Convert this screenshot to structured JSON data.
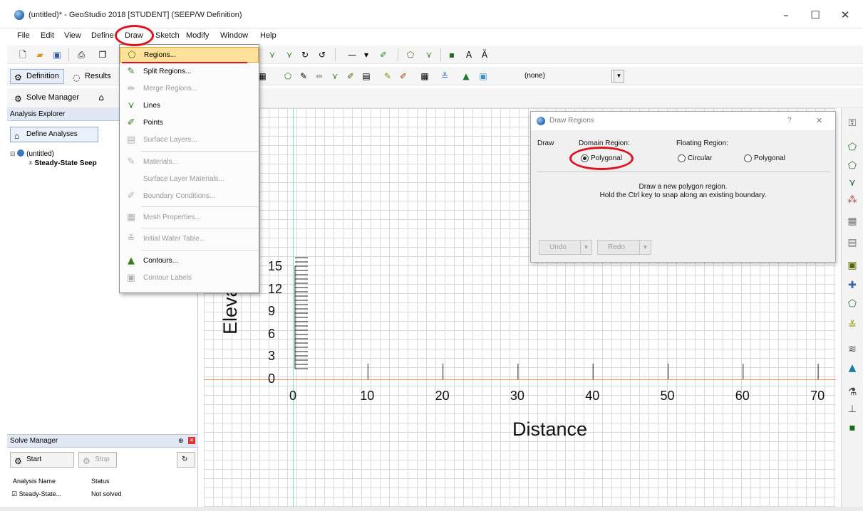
{
  "window": {
    "title": "(untitled)* - GeoStudio 2018 [STUDENT] (SEEP/W Definition)",
    "minimize": "–",
    "maximize": "☐",
    "close": "✕"
  },
  "menu": [
    "File",
    "Edit",
    "View",
    "Define",
    "Draw",
    "Sketch",
    "Modify",
    "Window",
    "Help"
  ],
  "toolbar": {
    "definition_label": "Definition",
    "results_label": "Results",
    "solve_manager_label": "Solve Manager",
    "combo_value": "(none)"
  },
  "explorer": {
    "title": "Analysis Explorer",
    "define_button": "Define Analyses",
    "tree_root": "(untitled)",
    "tree_child": "Steady-State Seep"
  },
  "solve_manager": {
    "title": "Solve Manager",
    "start_label": "Start",
    "stop_label": "Stop",
    "col_name": "Analysis Name",
    "col_status": "Status",
    "rows": [
      {
        "name": "Steady-State...",
        "status": "Not solved"
      }
    ]
  },
  "draw_menu": {
    "items": [
      {
        "label": "Regions...",
        "icon": "regions-icon",
        "glyph": "⬠",
        "disabled": false,
        "highlight": true
      },
      {
        "label": "Split Regions...",
        "icon": "split-regions-icon",
        "glyph": "✎",
        "disabled": false
      },
      {
        "label": "Merge Regions...",
        "icon": "merge-regions-icon",
        "glyph": "⇹",
        "disabled": true
      },
      {
        "label": "Lines",
        "icon": "lines-icon",
        "glyph": "⋎",
        "disabled": false
      },
      {
        "label": "Points",
        "icon": "points-icon",
        "glyph": "✐",
        "disabled": false
      },
      {
        "label": "Surface Layers...",
        "icon": "surface-layers-icon",
        "glyph": "▤",
        "disabled": true
      },
      {
        "label": "Materials...",
        "icon": "materials-icon",
        "glyph": "✎",
        "disabled": true
      },
      {
        "label": "Surface Layer Materials...",
        "icon": "",
        "glyph": "",
        "disabled": true
      },
      {
        "label": "Boundary Conditions...",
        "icon": "boundary-conditions-icon",
        "glyph": "✐",
        "disabled": true
      },
      {
        "label": "Mesh Properties...",
        "icon": "mesh-properties-icon",
        "glyph": "▦",
        "disabled": true
      },
      {
        "label": "Initial Water Table...",
        "icon": "water-table-icon",
        "glyph": "≚",
        "disabled": true
      },
      {
        "label": "Contours...",
        "icon": "contours-icon",
        "glyph": "▲",
        "disabled": false
      },
      {
        "label": "Contour Labels",
        "icon": "contour-labels-icon",
        "glyph": "▣",
        "disabled": true
      }
    ]
  },
  "dialog": {
    "title": "Draw Regions",
    "help": "?",
    "close": "✕",
    "draw_label": "Draw",
    "domain_label": "Domain Region:",
    "domain_option": "Polygonal",
    "floating_label": "Floating Region:",
    "floating_circular": "Circular",
    "floating_polygonal": "Polygonal",
    "hint_line1": "Draw a new polygon region.",
    "hint_line2": "Hold the Ctrl key to snap along an existing boundary.",
    "undo_label": "Undo",
    "redo_label": "Redo"
  },
  "canvas": {
    "y_axis_label": "Elevation",
    "x_axis_label": "Distance",
    "y_ticks": [
      "15",
      "12",
      "9",
      "6",
      "3",
      "0"
    ],
    "x_ticks": [
      "0",
      "10",
      "20",
      "30",
      "40",
      "50",
      "60",
      "70"
    ]
  },
  "colors": {
    "annotation_red": "#e0141e",
    "menu_highlight": "#ffe29a",
    "x_axis_line": "#ff8c5a",
    "y_axis_line": "#7fe0c8"
  }
}
